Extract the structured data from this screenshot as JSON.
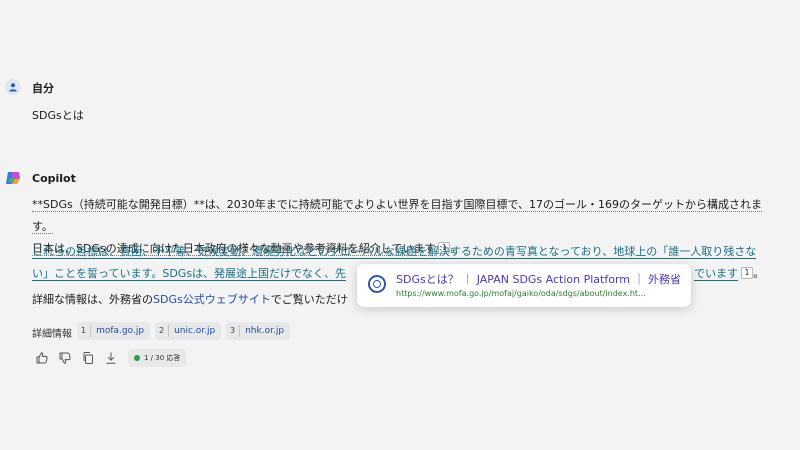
{
  "user": {
    "name": "自分",
    "message": "SDGsとは"
  },
  "copilot": {
    "name": "Copilot",
    "p1_line1": "**SDGs（持続可能な開発目標）**は、2030年までに持続可能でよりよい世界を目指す国際目標で、17のゴール・169のターゲットから構成されます。",
    "p1_line2": "日本は、SDGsの達成に向けた日本政府の様々な動画や参考資料を紹介しています",
    "p1_cite": "1",
    "p1_end": "。",
    "p2_line1": "これらの目標は、貧困、不平等、気候変動、環境劣化などのグローバルな課題を解決するための青写真となっており、地球上の「誰一人取り残さな",
    "p2_line2a": "い」ことを誓っています。SDGsは、発展途上国だけでなく、先",
    "p2_line2b": "でいます",
    "p2_cite": "1",
    "p2_end": "。",
    "p3_start": "詳細な情報は、外務省の",
    "p3_link": "SDGs公式ウェブサイト",
    "p3_end": "でご覧いただけ"
  },
  "tooltip": {
    "title": "SDGsとは？ ｜ JAPAN SDGs Action Platform ｜ 外務省",
    "url": "https://www.mofa.go.jp/mofaj/gaiko/oda/sdgs/about/index.ht..."
  },
  "more_info": {
    "label": "詳細情報",
    "sources": [
      {
        "num": "1",
        "domain": "mofa.go.jp"
      },
      {
        "num": "2",
        "domain": "unic.or.jp"
      },
      {
        "num": "3",
        "domain": "nhk.or.jp"
      }
    ]
  },
  "actions": {
    "counter": "1 / 30 応答",
    "icons": [
      "thumbs-up-icon",
      "thumbs-down-icon",
      "copy-icon",
      "download-icon"
    ]
  },
  "colors": {
    "background": "#f3f3f4",
    "link": "#1f4ea8",
    "highlight_text": "#1b6f86",
    "tooltip_title": "#4b3ab2",
    "tooltip_url": "#2e7d32",
    "status_dot": "#2e9c47"
  }
}
